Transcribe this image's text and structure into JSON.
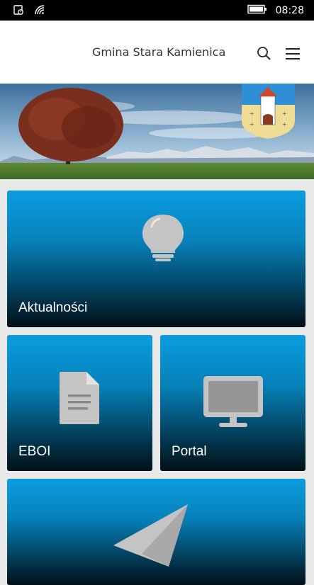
{
  "status_bar": {
    "time": "08:28",
    "icons": [
      "notification-icon",
      "wifi-icon",
      "battery-icon"
    ]
  },
  "header": {
    "title": "Gmina Stara Kamienica",
    "icons": [
      "search-icon",
      "hamburger-menu-icon"
    ]
  },
  "banner": {
    "description_icons": [
      "tree-landscape-image",
      "coat-of-arms-icon"
    ]
  },
  "tiles": [
    {
      "label": "Aktualności",
      "icon": "lightbulb-icon"
    },
    {
      "label": "EBOI",
      "icon": "document-icon"
    },
    {
      "label": "Portal",
      "icon": "monitor-icon"
    },
    {
      "label": "",
      "icon": "paper-plane-icon"
    }
  ],
  "colors": {
    "tile_top": "#0a9de0",
    "tile_bottom": "#021017",
    "header_bg": "#ffffff",
    "page_bg": "#e9e9e9",
    "icon_gray": "#c4c4c4"
  }
}
